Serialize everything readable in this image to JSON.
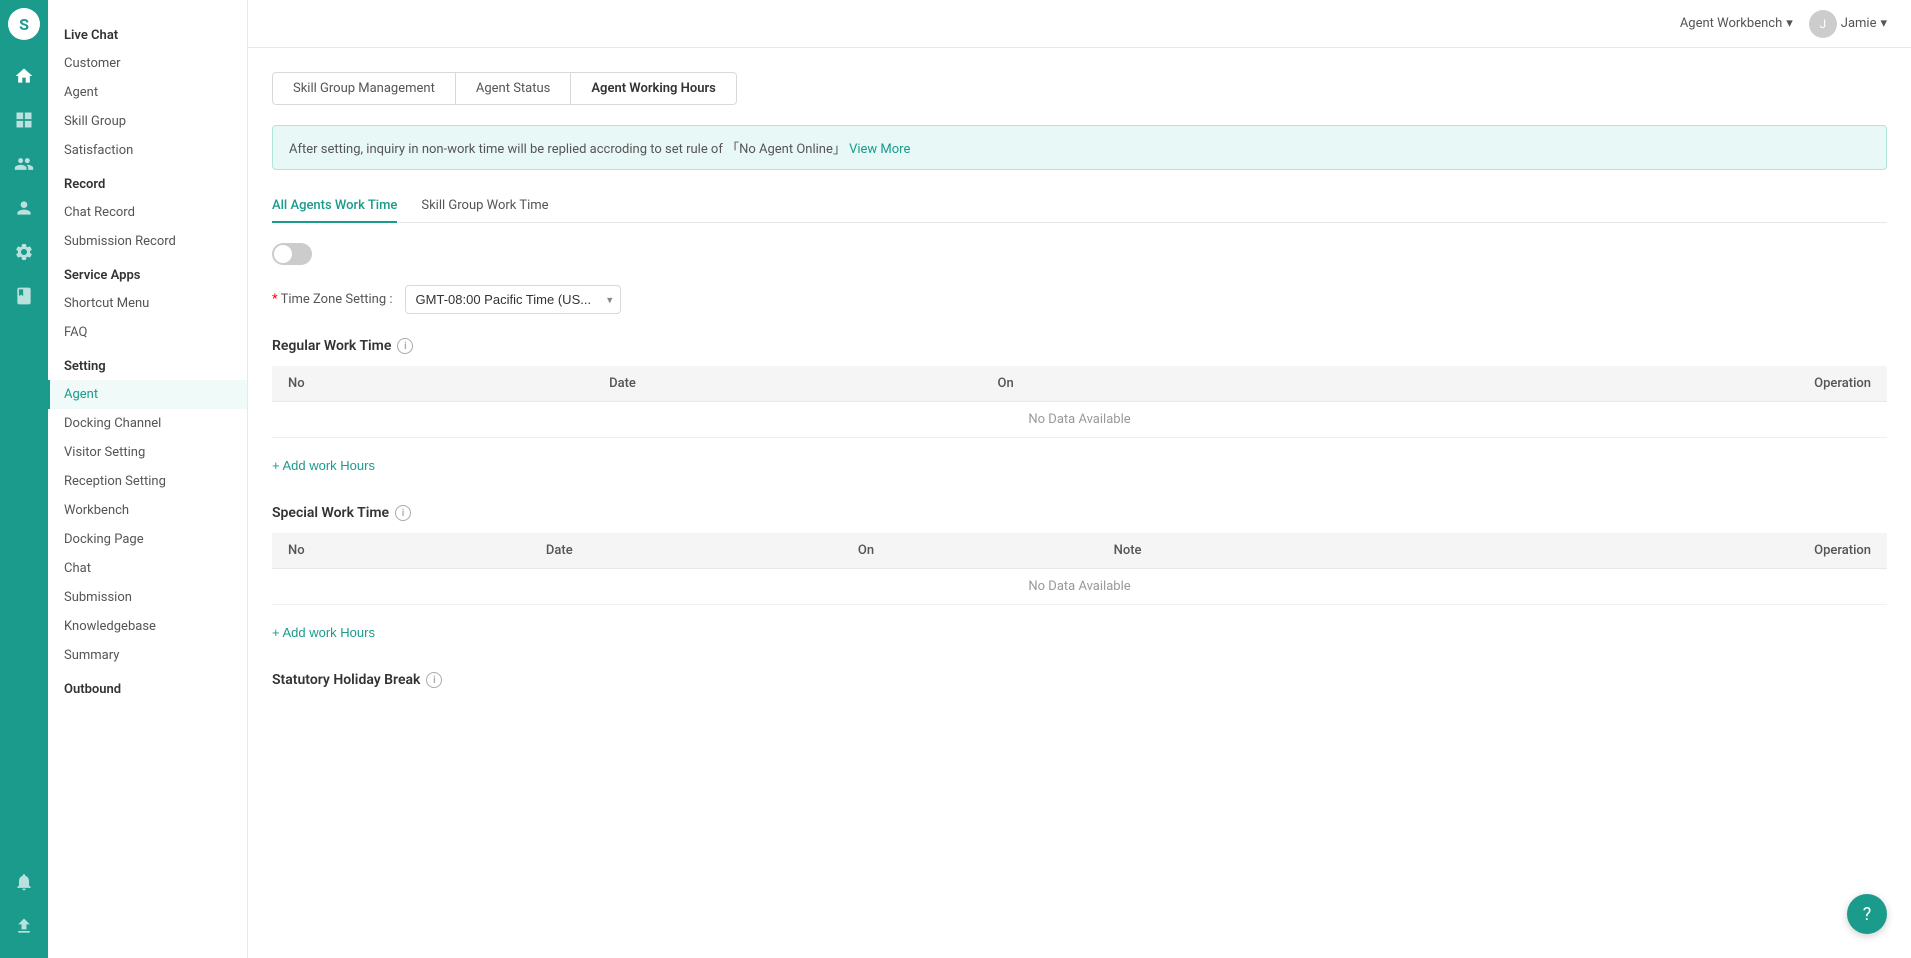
{
  "app": {
    "logo": "S",
    "logo_bg": "#1a9b8c"
  },
  "header": {
    "workbench_label": "Agent Workbench",
    "user_label": "Jamie",
    "dropdown_arrow": "▾"
  },
  "tabs": {
    "items": [
      {
        "id": "skill-group",
        "label": "Skill Group Management",
        "active": false
      },
      {
        "id": "agent-status",
        "label": "Agent Status",
        "active": false
      },
      {
        "id": "agent-working-hours",
        "label": "Agent Working Hours",
        "active": true
      }
    ]
  },
  "info_banner": {
    "text": "After setting, inquiry in non-work time will be replied accroding to set rule of 「No Agent Online」",
    "link_text": "View More"
  },
  "sub_tabs": [
    {
      "id": "all-agents",
      "label": "All Agents Work Time",
      "active": true
    },
    {
      "id": "skill-group",
      "label": "Skill Group Work Time",
      "active": false
    }
  ],
  "timezone": {
    "label": "Time Zone Setting :",
    "value": "GMT-08:00 Pacific Time (US...",
    "required": "*"
  },
  "regular_work_time": {
    "title": "Regular Work Time",
    "columns": [
      "No",
      "Date",
      "On",
      "Operation"
    ],
    "no_data": "No Data Available",
    "add_label": "+ Add work Hours"
  },
  "special_work_time": {
    "title": "Special Work Time",
    "columns": [
      "No",
      "Date",
      "On",
      "Note",
      "Operation"
    ],
    "no_data": "No Data Available",
    "add_label": "+ Add work Hours"
  },
  "statutory_holiday": {
    "title": "Statutory Holiday Break"
  },
  "nav": {
    "live_chat": {
      "title": "Live Chat",
      "items": [
        "Customer",
        "Agent",
        "Skill Group",
        "Satisfaction"
      ]
    },
    "record": {
      "title": "Record",
      "items": [
        "Chat Record",
        "Submission Record"
      ]
    },
    "service_apps": {
      "title": "Service Apps",
      "items": [
        "Shortcut Menu",
        "FAQ"
      ]
    },
    "setting": {
      "title": "Setting",
      "items": [
        "Agent",
        "Docking Channel",
        "Visitor Setting",
        "Reception Setting",
        "Workbench",
        "Docking Page",
        "Chat",
        "Submission",
        "Knowledgebase",
        "Summary"
      ]
    },
    "outbound": {
      "title": "Outbound"
    }
  },
  "icons": {
    "home": "🏠",
    "grid": "⊞",
    "users": "👤",
    "person": "👤",
    "settings": "⚙",
    "book": "📖",
    "bell": "🔔",
    "upload": "⬆"
  }
}
